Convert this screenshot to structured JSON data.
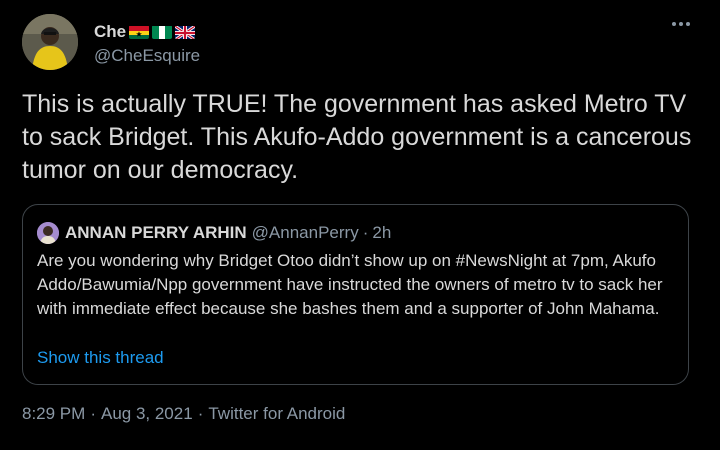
{
  "author": {
    "display_name": "Che",
    "handle": "@CheEsquire",
    "flags": [
      "ghana-flag-icon",
      "nigeria-flag-icon",
      "uk-flag-icon"
    ]
  },
  "tweet_text": "This is actually TRUE! The government has asked Metro TV to sack Bridget. This Akufo-Addo government is a cancerous tumor on our democracy.",
  "quoted_tweet": {
    "author_name": "ANNAN PERRY ARHIN",
    "author_handle": "@AnnanPerry",
    "separator": "·",
    "time": "2h",
    "text": "Are you wondering why Bridget Otoo didn’t show up on #NewsNight at 7pm, Akufo Addo/Bawumia/Npp government have instructed the owners of metro tv to sack her with immediate effect because she bashes them and a supporter of John Mahama.",
    "show_thread_label": "Show this thread"
  },
  "meta": {
    "time": "8:29 PM",
    "date": "Aug 3, 2021",
    "source": "Twitter for Android",
    "separator": "·"
  },
  "colors": {
    "background": "#000000",
    "text": "#d9d9d9",
    "secondary_text": "#8b98a5",
    "link": "#1d9bf0",
    "border": "#3d4348"
  },
  "icons": {
    "more": "more-options-icon"
  }
}
